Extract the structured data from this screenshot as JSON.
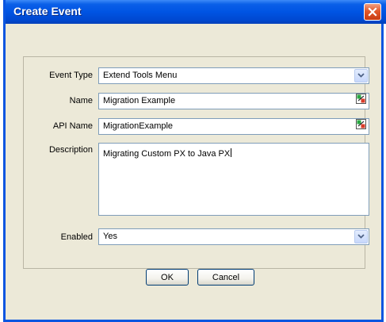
{
  "dialog": {
    "title": "Create Event",
    "close_icon": "close-icon"
  },
  "form": {
    "event_type": {
      "label": "Event Type",
      "value": "Extend Tools Menu"
    },
    "name": {
      "label": "Name",
      "value": "Migration Example"
    },
    "api_name": {
      "label": "API Name",
      "value": "MigrationExample"
    },
    "description": {
      "label": "Description",
      "value": "Migrating Custom PX to Java PX"
    },
    "enabled": {
      "label": "Enabled",
      "value": "Yes"
    }
  },
  "buttons": {
    "ok_label": "OK",
    "cancel_label": "Cancel"
  },
  "colors": {
    "titlebar": "#0054e3",
    "window_bg": "#ece9d8",
    "close": "#e2582a",
    "field_border": "#7f9db9"
  }
}
